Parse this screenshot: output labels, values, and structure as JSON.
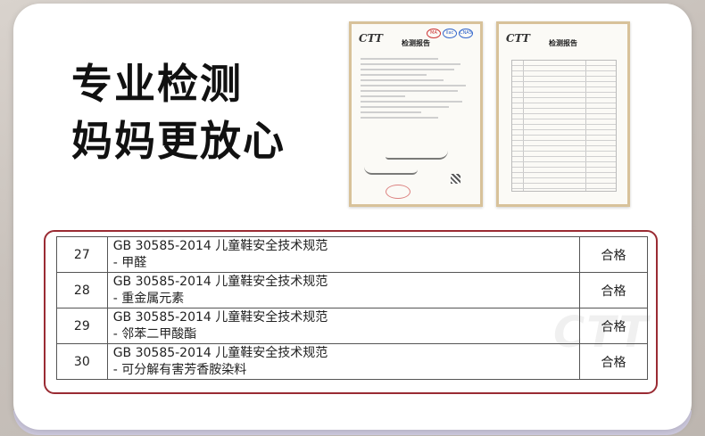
{
  "headline": {
    "line1": "专业检测",
    "line2": "妈妈更放心"
  },
  "certificates": [
    {
      "logo": "CTT",
      "title": "检测报告",
      "marks": [
        "MA",
        "ilac",
        "CNAS"
      ]
    },
    {
      "logo": "CTT",
      "title": "检测报告"
    }
  ],
  "watermark": "CTT",
  "results_table": {
    "rows": [
      {
        "no": "27",
        "standard": "GB 30585-2014 儿童鞋安全技术规范",
        "item": "- 甲醛",
        "result": "合格"
      },
      {
        "no": "28",
        "standard": "GB 30585-2014 儿童鞋安全技术规范",
        "item": "- 重金属元素",
        "result": "合格"
      },
      {
        "no": "29",
        "standard": "GB 30585-2014 儿童鞋安全技术规范",
        "item": "- 邻苯二甲酸酯",
        "result": "合格"
      },
      {
        "no": "30",
        "standard": "GB 30585-2014 儿童鞋安全技术规范",
        "item": "- 可分解有害芳香胺染料",
        "result": "合格"
      }
    ]
  },
  "colors": {
    "frame": "#9a2b33",
    "cert_border": "#d8c29a",
    "background": "#c9c2bc"
  }
}
